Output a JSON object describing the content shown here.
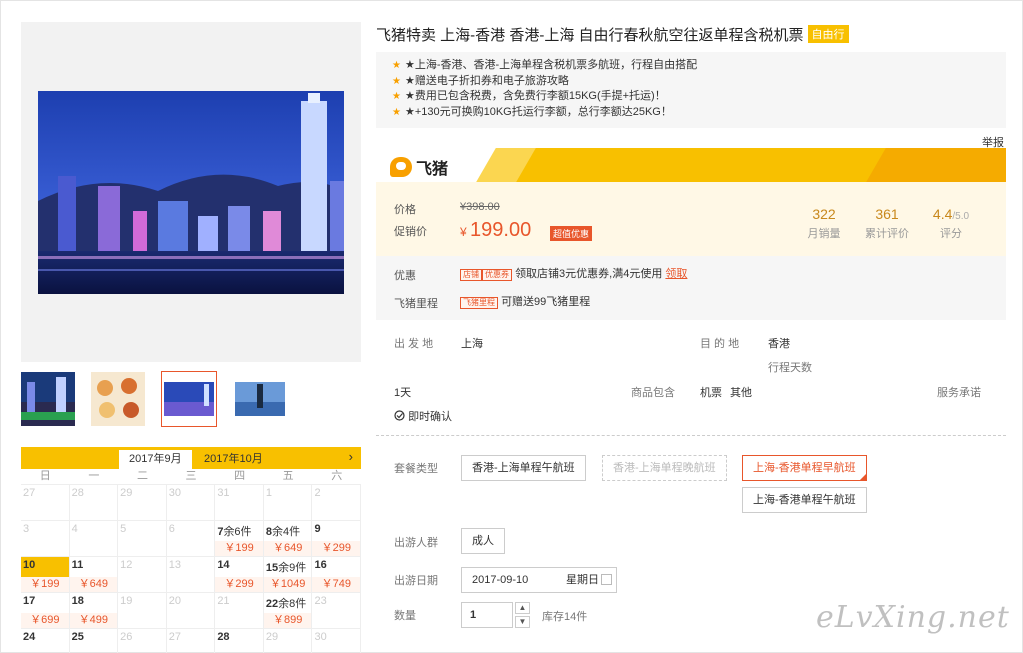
{
  "product": {
    "title": "飞猪特卖 上海-香港 香港-上海 自由行春秋航空往返单程含税机票",
    "title_tag": "自由行",
    "highlights": [
      "★上海-香港、香港-上海单程含税机票多航班，行程自由搭配",
      "★赠送电子折扣券和电子旅游攻略",
      "★费用已包含税费，含免费行李额15KG(手提+托运)！",
      "★+130元可换购10KG托运行李额，总行李额达25KG！"
    ],
    "report": "举报"
  },
  "brand": {
    "name": "飞猪"
  },
  "price": {
    "price_label": "价格",
    "original": "¥398.00",
    "promo_label": "促销价",
    "currency": "¥",
    "current": "199.00",
    "deal_badge": "超值优惠",
    "stats": [
      {
        "value": "322",
        "label": "月销量"
      },
      {
        "value": "361",
        "label": "累计评价"
      },
      {
        "value": "4.4",
        "suffix": "/5.0",
        "label": "评分"
      }
    ]
  },
  "promo": {
    "coupon_label": "优惠",
    "coupon_tag1": "店铺",
    "coupon_tag2": "优惠券",
    "coupon_text": "领取店铺3元优惠券,满4元使用",
    "coupon_link": "领取",
    "miles_label": "飞猪里程",
    "miles_tag": "飞猪里程",
    "miles_text": "可赠送99飞猪里程"
  },
  "trip": {
    "from_label": "出 发 地",
    "from": "上海",
    "to_label": "目 的 地",
    "to": "香港",
    "days_label": "行程天数",
    "days": "1天",
    "includes_label": "商品包含",
    "includes_items": [
      "机票",
      "其他"
    ],
    "service_label": "服务承诺",
    "confirm": "即时确认"
  },
  "options": {
    "package_label": "套餐类型",
    "packages": [
      {
        "label": "香港-上海单程午航班",
        "state": "normal"
      },
      {
        "label": "香港-上海单程晚航班",
        "state": "disabled"
      },
      {
        "label": "上海-香港单程早航班",
        "state": "selected"
      },
      {
        "label": "上海-香港单程午航班",
        "state": "normal"
      }
    ],
    "people_label": "出游人群",
    "people": "成人",
    "date_label": "出游日期",
    "date": "2017-09-10",
    "weekday": "星期日",
    "qty_label": "数量",
    "qty": "1",
    "stock": "库存14件",
    "step_up": "▲",
    "step_down": "▼"
  },
  "calendar": {
    "tabs": [
      "2017年9月",
      "2017年10月"
    ],
    "next": "›",
    "weekdays": [
      "日",
      "一",
      "二",
      "三",
      "四",
      "五",
      "六"
    ],
    "rows": [
      [
        {
          "d": "27",
          "dim": true
        },
        {
          "d": "28",
          "dim": true
        },
        {
          "d": "29",
          "dim": true
        },
        {
          "d": "30",
          "dim": true
        },
        {
          "d": "31",
          "dim": true
        },
        {
          "d": "1",
          "dim": true
        },
        {
          "d": "2",
          "dim": true
        }
      ],
      [
        {
          "d": "3",
          "dim": true
        },
        {
          "d": "4",
          "dim": true
        },
        {
          "d": "5",
          "dim": true
        },
        {
          "d": "6",
          "dim": true
        },
        {
          "d": "7",
          "rem": "余6件",
          "p": "￥199"
        },
        {
          "d": "8",
          "rem": "余4件",
          "p": "￥649"
        },
        {
          "d": "9",
          "p": "￥299"
        }
      ],
      [
        {
          "d": "10",
          "p": "￥199",
          "sel": true
        },
        {
          "d": "11",
          "p": "￥649"
        },
        {
          "d": "12",
          "dim": true
        },
        {
          "d": "13",
          "dim": true
        },
        {
          "d": "14",
          "p": "￥299"
        },
        {
          "d": "15",
          "rem": "余9件",
          "p": "￥1049"
        },
        {
          "d": "16",
          "p": "￥749"
        }
      ],
      [
        {
          "d": "17",
          "p": "￥699"
        },
        {
          "d": "18",
          "p": "￥499"
        },
        {
          "d": "19",
          "dim": true
        },
        {
          "d": "20",
          "dim": true
        },
        {
          "d": "21",
          "dim": true
        },
        {
          "d": "22",
          "rem": "余8件",
          "p": "￥899"
        },
        {
          "d": "23",
          "dim": true
        }
      ],
      [
        {
          "d": "24"
        },
        {
          "d": "25"
        },
        {
          "d": "26",
          "dim": true
        },
        {
          "d": "27",
          "dim": true
        },
        {
          "d": "28"
        },
        {
          "d": "29",
          "dim": true
        },
        {
          "d": "30",
          "dim": true
        }
      ]
    ]
  },
  "watermark": "eLvXing.net"
}
